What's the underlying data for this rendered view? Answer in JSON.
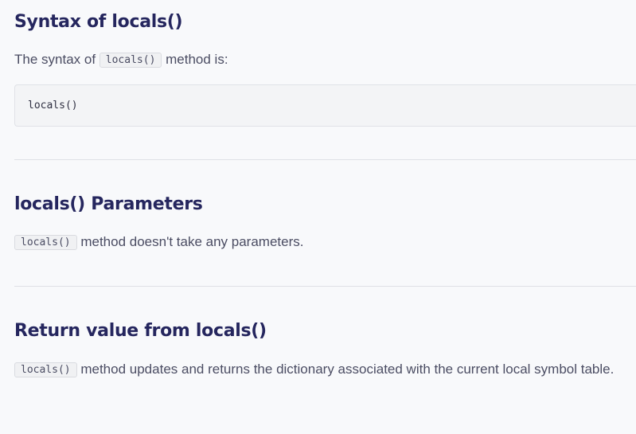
{
  "syntax_section": {
    "title": "Syntax of locals()",
    "text_before": "The syntax of ",
    "inline_code": "locals()",
    "text_after": " method is:",
    "code_block": "locals()"
  },
  "parameters_section": {
    "title": "locals() Parameters",
    "inline_code": "locals()",
    "text_after": " method doesn't take any parameters."
  },
  "return_section": {
    "title": "Return value from locals()",
    "inline_code": "locals()",
    "text_after": " method updates and returns the dictionary associated with the current local symbol table."
  }
}
